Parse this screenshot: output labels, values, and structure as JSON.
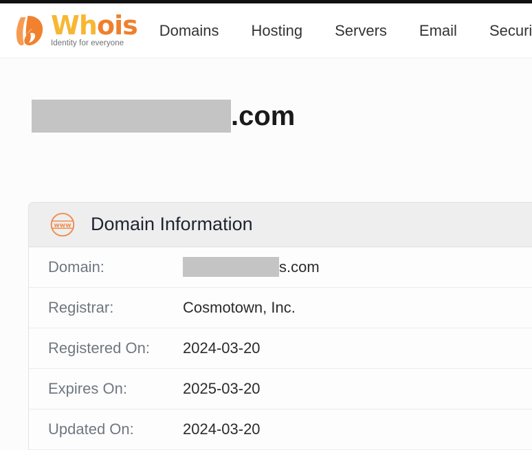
{
  "header": {
    "logo": {
      "word_part1": "Wh",
      "word_part2": "ois",
      "tagline": "Identity for everyone",
      "mark_icon": "hand-swoosh-icon"
    },
    "nav": [
      {
        "label": "Domains"
      },
      {
        "label": "Hosting"
      },
      {
        "label": "Servers"
      },
      {
        "label": "Email"
      },
      {
        "label": "Securit"
      }
    ]
  },
  "page": {
    "title_redacted": "",
    "title_tld": ".com"
  },
  "card": {
    "icon": "www-globe-icon",
    "title": "Domain Information",
    "rows": [
      {
        "label": "Domain:",
        "value": "s.com",
        "redacted": true
      },
      {
        "label": "Registrar:",
        "value": "Cosmotown, Inc.",
        "redacted": false
      },
      {
        "label": "Registered On:",
        "value": "2024-03-20",
        "redacted": false
      },
      {
        "label": "Expires On:",
        "value": "2025-03-20",
        "redacted": false
      },
      {
        "label": "Updated On:",
        "value": "2024-03-20",
        "redacted": false
      }
    ]
  },
  "colors": {
    "brand_orange": "#f07f2d",
    "brand_gold": "#f7b733",
    "redaction_gray": "#c4c4c4",
    "card_header_bg": "#eeeeee",
    "label_gray": "#6f7780"
  }
}
